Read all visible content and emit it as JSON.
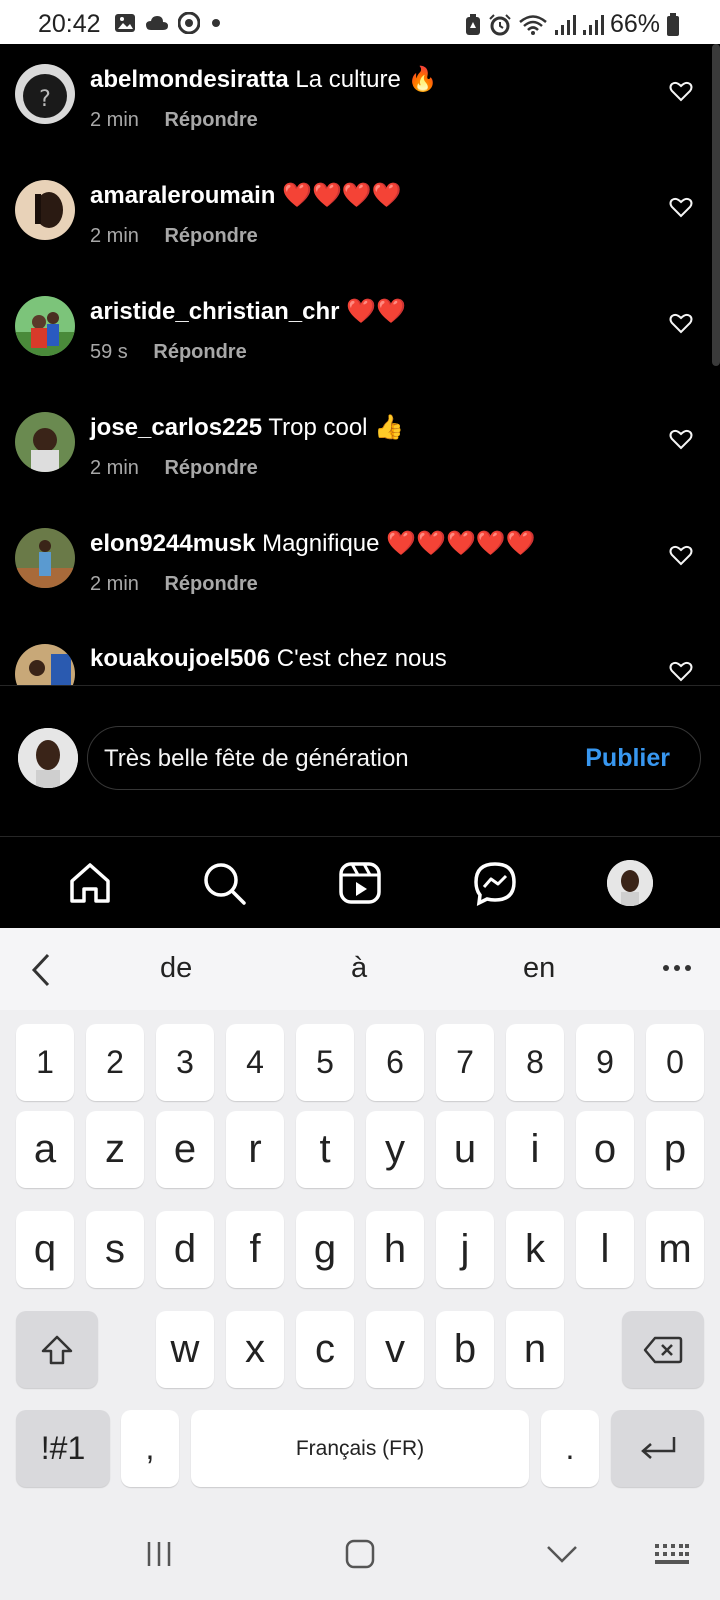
{
  "status_bar": {
    "time": "20:42",
    "left_icons": [
      "gallery-icon",
      "cloud-icon",
      "chrome-icon",
      "dot-icon"
    ],
    "right_icons": [
      "battery-saver-icon",
      "alarm-icon",
      "wifi-icon",
      "signal-icon",
      "signal-icon"
    ],
    "battery": "66%"
  },
  "comments": [
    {
      "username": "abelmondesiratta",
      "text": "La culture",
      "emoji": "🔥",
      "time": "2 min",
      "reply": "Répondre"
    },
    {
      "username": "amaraleroumain",
      "text": "",
      "emoji": "❤️❤️❤️❤️",
      "time": "2 min",
      "reply": "Répondre"
    },
    {
      "username": "aristide_christian_chr",
      "text": "",
      "emoji": "❤️❤️",
      "time": "59 s",
      "reply": "Répondre"
    },
    {
      "username": "jose_carlos225",
      "text": "Trop cool",
      "emoji": "👍",
      "time": "2 min",
      "reply": "Répondre"
    },
    {
      "username": "elon9244musk",
      "text": "Magnifique",
      "emoji": "❤️❤️❤️❤️❤️",
      "time": "2 min",
      "reply": "Répondre"
    },
    {
      "username": "kouakoujoel506",
      "text": "C'est chez nous",
      "emoji": "",
      "time": "",
      "reply": ""
    }
  ],
  "composer": {
    "value": "Très belle fête de génération",
    "publish_label": "Publier"
  },
  "nav": [
    "home-icon",
    "search-icon",
    "reels-icon",
    "messenger-icon",
    "profile-avatar"
  ],
  "keyboard": {
    "suggestions": [
      "de",
      "à",
      "en"
    ],
    "number_row": [
      "1",
      "2",
      "3",
      "4",
      "5",
      "6",
      "7",
      "8",
      "9",
      "0"
    ],
    "row1": [
      "a",
      "z",
      "e",
      "r",
      "t",
      "y",
      "u",
      "i",
      "o",
      "p"
    ],
    "row2": [
      "q",
      "s",
      "d",
      "f",
      "g",
      "h",
      "j",
      "k",
      "l",
      "m"
    ],
    "row3": [
      "w",
      "x",
      "c",
      "v",
      "b",
      "n"
    ],
    "symbols_label": "!#1",
    "comma": ",",
    "space_label": "Français (FR)",
    "period": "."
  },
  "colors": {
    "accent": "#3897f0",
    "background": "#000000",
    "heart": "#ff1f3d"
  }
}
